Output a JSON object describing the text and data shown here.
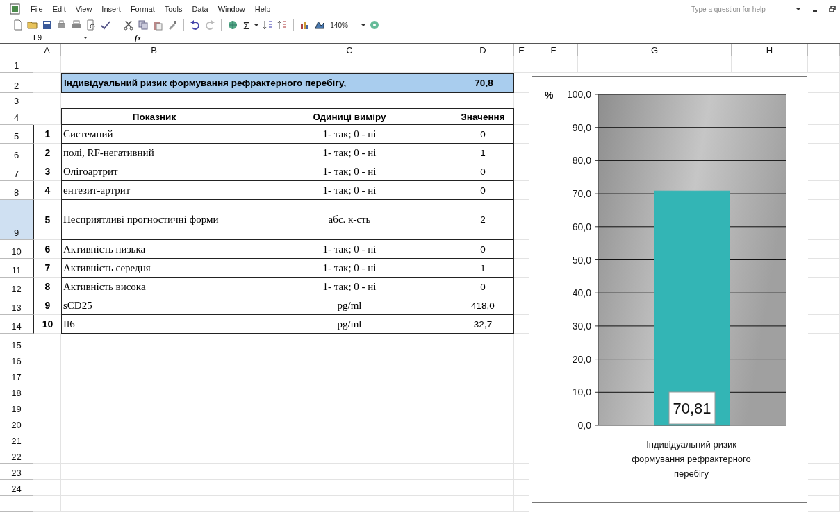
{
  "menu": [
    {
      "label": "File"
    },
    {
      "label": "Edit"
    },
    {
      "label": "View"
    },
    {
      "label": "Insert"
    },
    {
      "label": "Format"
    },
    {
      "label": "Tools"
    },
    {
      "label": "Data"
    },
    {
      "label": "Window"
    },
    {
      "label": "Help"
    }
  ],
  "help_box": {
    "placeholder": "Type a question for help"
  },
  "toolbar": {
    "sum": "Σ",
    "zoom": "140%"
  },
  "formula_bar": {
    "name_box": "L9",
    "fx": "fx"
  },
  "columns": [
    {
      "label": "A"
    },
    {
      "label": "B"
    },
    {
      "label": "C"
    },
    {
      "label": "D"
    },
    {
      "label": "E"
    },
    {
      "label": "F"
    },
    {
      "label": "G"
    },
    {
      "label": "H"
    }
  ],
  "rows": [
    {
      "label": "1",
      "selected": false
    },
    {
      "label": "2",
      "selected": false
    },
    {
      "label": "3",
      "selected": false
    },
    {
      "label": "4",
      "selected": false
    },
    {
      "label": "5",
      "selected": false
    },
    {
      "label": "6",
      "selected": false
    },
    {
      "label": "7",
      "selected": false
    },
    {
      "label": "8",
      "selected": false
    },
    {
      "label": "9",
      "selected": true
    },
    {
      "label": "10",
      "selected": false
    },
    {
      "label": "11",
      "selected": false
    },
    {
      "label": "12",
      "selected": false
    },
    {
      "label": "13",
      "selected": false
    },
    {
      "label": "14",
      "selected": false
    },
    {
      "label": "15",
      "selected": false
    },
    {
      "label": "16",
      "selected": false
    },
    {
      "label": "17",
      "selected": false
    },
    {
      "label": "18",
      "selected": false
    },
    {
      "label": "19",
      "selected": false
    },
    {
      "label": "20",
      "selected": false
    },
    {
      "label": "21",
      "selected": false
    },
    {
      "label": "22",
      "selected": false
    },
    {
      "label": "23",
      "selected": false
    },
    {
      "label": "24",
      "selected": false
    }
  ],
  "title": {
    "text": "Індивідуальний ризик формування рефрактерного перебігу,",
    "value": "70,8"
  },
  "table": {
    "columns": [
      "Показник",
      "Одиниці виміру",
      "Значення"
    ],
    "rows": [
      {
        "num": "1",
        "name": "Системний",
        "unit": "1- так; 0 - ні",
        "value": "0"
      },
      {
        "num": "2",
        "name": "полі, RF-негативний",
        "unit": "1- так; 0 - ні",
        "value": "1"
      },
      {
        "num": "3",
        "name": "Олігоартрит",
        "unit": "1- так; 0 - ні",
        "value": "0"
      },
      {
        "num": "4",
        "name": "ентезит-артрит",
        "unit": "1- так; 0 - ні",
        "value": "0"
      },
      {
        "num": "5",
        "name": "Несприятливі прогностичні форми",
        "unit": "абс. к-сть",
        "value": "2"
      },
      {
        "num": "6",
        "name": "Активність низька",
        "unit": "1- так; 0 - ні",
        "value": "0"
      },
      {
        "num": "7",
        "name": "Активність середня",
        "unit": "1- так; 0 - ні",
        "value": "1"
      },
      {
        "num": "8",
        "name": "Активність висока",
        "unit": "1- так; 0 - ні",
        "value": "0"
      },
      {
        "num": "9",
        "name": "sCD25",
        "unit": "pg/ml",
        "value": "418,0"
      },
      {
        "num": "10",
        "name": "Il6",
        "unit": "pg/ml",
        "value": "32,7"
      }
    ]
  },
  "chart": {
    "chart_data": {
      "type": "bar",
      "ylabel": "%",
      "categories": [
        "Індивідуальний ризик формування рефрактерного перебігу"
      ],
      "series": [
        {
          "color": "#33b5b5",
          "values": [
            70.81
          ]
        }
      ],
      "grid": true,
      "ylim": [
        0,
        100
      ],
      "yticks": [
        {
          "value": 0,
          "label": "0,0"
        },
        {
          "value": 10,
          "label": "10,0"
        },
        {
          "value": 20,
          "label": "20,0"
        },
        {
          "value": 30,
          "label": "30,0"
        },
        {
          "value": 40,
          "label": "40,0"
        },
        {
          "value": 50,
          "label": "50,0"
        },
        {
          "value": 60,
          "label": "60,0"
        },
        {
          "value": 70,
          "label": "70,0"
        },
        {
          "value": 80,
          "label": "80,0"
        },
        {
          "value": 90,
          "label": "90,0"
        },
        {
          "value": 100,
          "label": "100,0"
        }
      ],
      "value_labels": [
        "70,81"
      ]
    }
  }
}
